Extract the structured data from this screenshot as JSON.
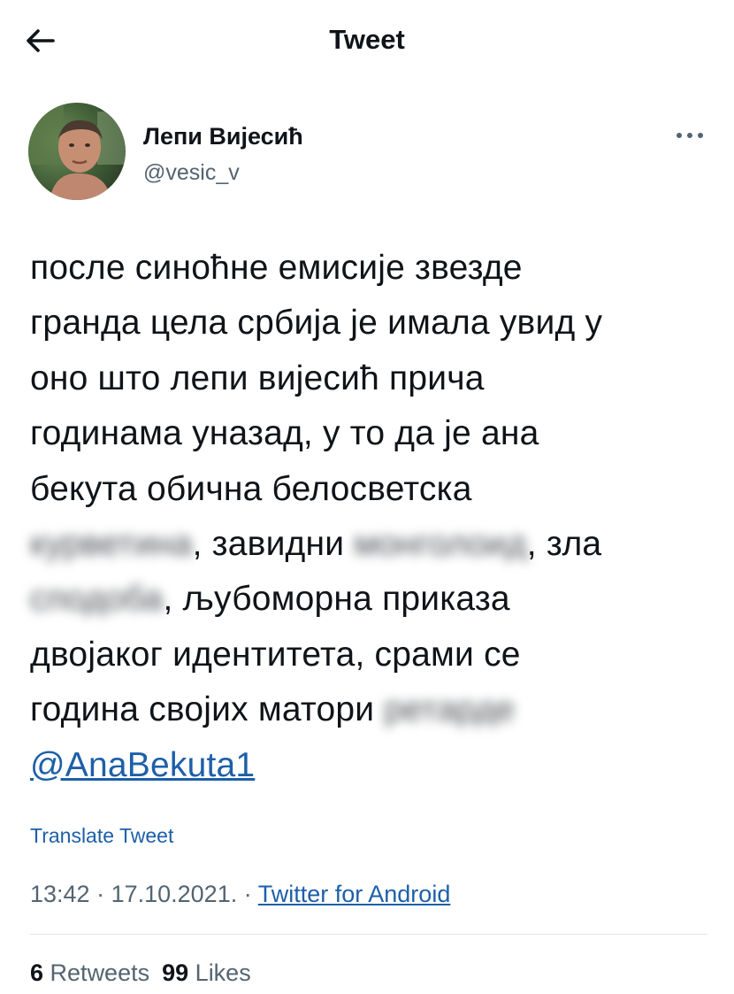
{
  "header": {
    "title": "Tweet",
    "back_icon": "arrow-left-icon"
  },
  "author": {
    "name": "Лепи Вијесић",
    "handle": "@vesic_v",
    "more_icon": "more-horizontal-icon"
  },
  "tweet": {
    "line1": "после синоћне емисије звезде",
    "line2": "гранда цела србија је имала увид у",
    "line3": "оно што лепи вијесић прича",
    "line4": "годинама уназад, у то да је ана",
    "line5": "бекута обична белосветска",
    "blurred1": "курветина",
    "line6_mid": ", завидни ",
    "blurred2": "монголоид",
    "line6_end": ", зла",
    "blurred3": "сподоба",
    "line7_end": ", љубоморна приказа",
    "line8": "двојаког идентитета, срами се",
    "line9": "година својих матори ",
    "blurred4": "ретарде",
    "mention": "@AnaBekuta1"
  },
  "translate_label": "Translate Tweet",
  "meta": {
    "time": "13:42",
    "sep1": " · ",
    "date": "17.10.2021.",
    "sep2": " · ",
    "source": "Twitter for Android"
  },
  "stats": {
    "retweets_count": "6",
    "retweets_label": "Retweets",
    "likes_count": "99",
    "likes_label": "Likes"
  },
  "colors": {
    "text": "#0f1419",
    "secondary": "#536471",
    "link": "#1d5fa8",
    "divider": "#e1e5e8"
  }
}
